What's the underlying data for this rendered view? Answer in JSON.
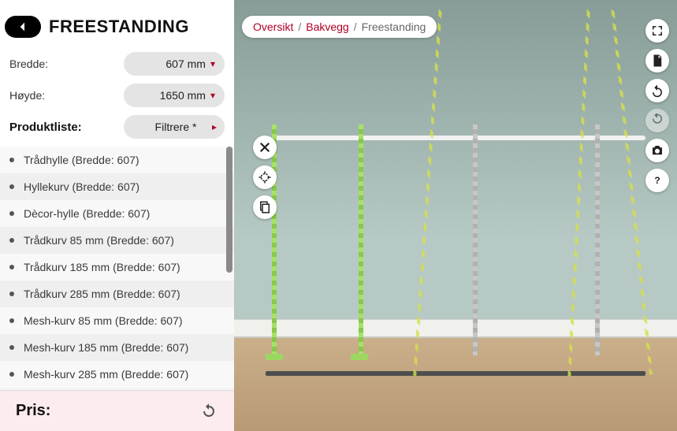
{
  "header": {
    "title": "FREESTANDING"
  },
  "controls": {
    "width_label": "Bredde:",
    "width_value": "607 mm",
    "height_label": "Høyde:",
    "height_value": "1650 mm",
    "productlist_label": "Produktliste:",
    "filter_label": "Filtrere *"
  },
  "products": [
    "Trådhylle (Bredde: 607)",
    "Hyllekurv (Bredde: 607)",
    "Dècor-hylle (Bredde: 607)",
    "Trådkurv 85 mm (Bredde: 607)",
    "Trådkurv  185 mm (Bredde: 607)",
    "Trådkurv 285 mm (Bredde: 607)",
    "Mesh-kurv 85 mm (Bredde: 607)",
    "Mesh-kurv 185 mm (Bredde: 607)",
    "Mesh-kurv 285 mm (Bredde: 607)"
  ],
  "footer": {
    "price_label": "Pris:"
  },
  "breadcrumb": {
    "l1": "Oversikt",
    "l2": "Bakvegg",
    "current": "Freestanding",
    "sep": "/"
  }
}
